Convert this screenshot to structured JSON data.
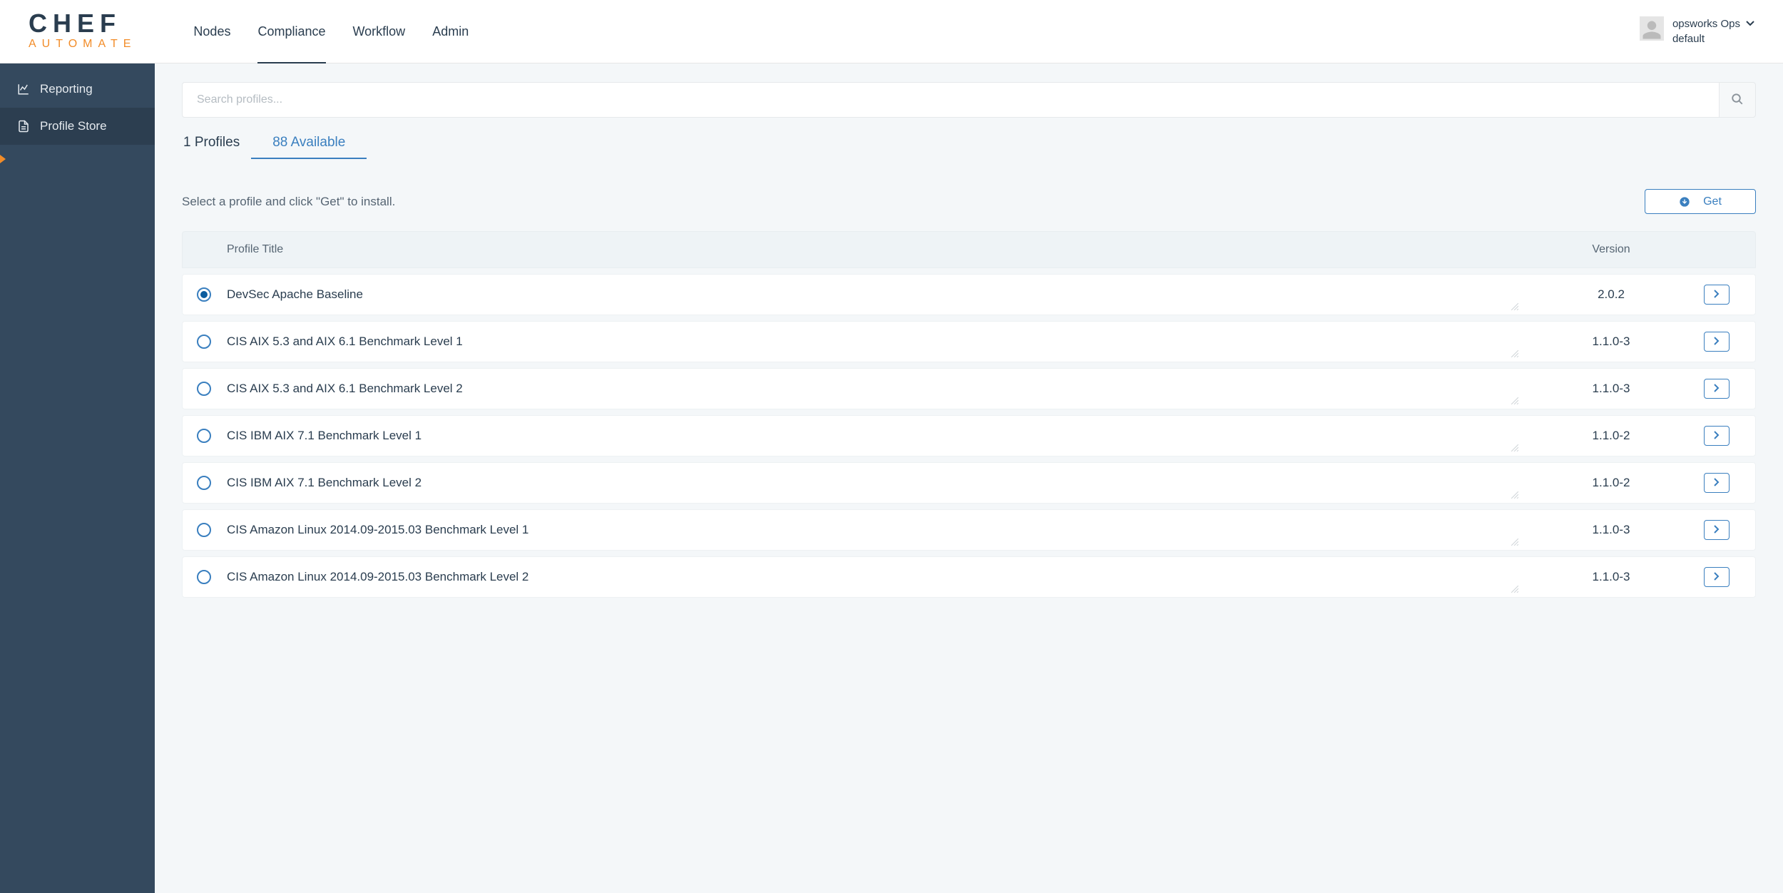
{
  "brand": {
    "line1": "CHEF",
    "line2": "AUTOMATE"
  },
  "topnav": [
    {
      "label": "Nodes",
      "active": false
    },
    {
      "label": "Compliance",
      "active": true
    },
    {
      "label": "Workflow",
      "active": false
    },
    {
      "label": "Admin",
      "active": false
    }
  ],
  "user": {
    "name": "opsworks Ops",
    "org": "default"
  },
  "sidebar": [
    {
      "label": "Reporting",
      "icon": "chart-icon",
      "active": false
    },
    {
      "label": "Profile Store",
      "icon": "document-icon",
      "active": true
    }
  ],
  "search": {
    "placeholder": "Search profiles..."
  },
  "tabs": [
    {
      "label": "1 Profiles",
      "active": false
    },
    {
      "label": "88 Available",
      "active": true
    }
  ],
  "instruction": "Select a profile and click \"Get\" to install.",
  "get_button": "Get",
  "table": {
    "headers": {
      "title": "Profile Title",
      "version": "Version"
    },
    "rows": [
      {
        "selected": true,
        "title": "DevSec Apache Baseline",
        "version": "2.0.2"
      },
      {
        "selected": false,
        "title": "CIS AIX 5.3 and AIX 6.1 Benchmark Level 1",
        "version": "1.1.0-3"
      },
      {
        "selected": false,
        "title": "CIS AIX 5.3 and AIX 6.1 Benchmark Level 2",
        "version": "1.1.0-3"
      },
      {
        "selected": false,
        "title": "CIS IBM AIX 7.1 Benchmark Level 1",
        "version": "1.1.0-2"
      },
      {
        "selected": false,
        "title": "CIS IBM AIX 7.1 Benchmark Level 2",
        "version": "1.1.0-2"
      },
      {
        "selected": false,
        "title": "CIS Amazon Linux 2014.09-2015.03 Benchmark Level 1",
        "version": "1.1.0-3"
      },
      {
        "selected": false,
        "title": "CIS Amazon Linux 2014.09-2015.03 Benchmark Level 2",
        "version": "1.1.0-3"
      }
    ]
  }
}
